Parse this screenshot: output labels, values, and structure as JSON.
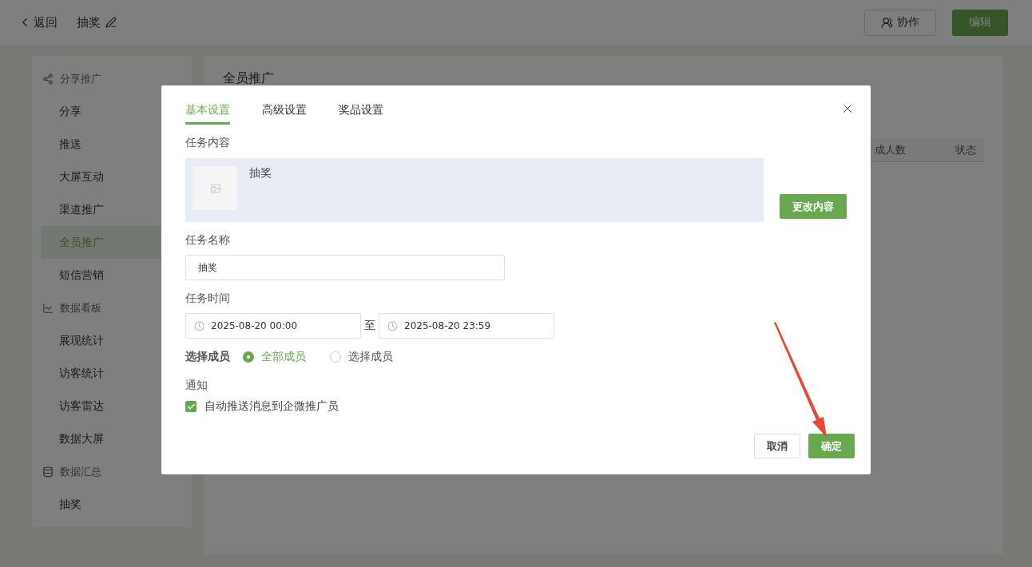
{
  "header": {
    "back": "返回",
    "title": "抽奖",
    "actions": [
      {
        "label": "协作",
        "kind": "outline"
      },
      {
        "label": "编辑",
        "kind": "primary"
      }
    ]
  },
  "sidebar": {
    "groups": [
      {
        "label": "分享推广",
        "kind": "share",
        "items": [
          {
            "label": "分享",
            "selected": false
          },
          {
            "label": "推送",
            "selected": false
          },
          {
            "label": "大屏互动",
            "selected": false
          },
          {
            "label": "渠道推广",
            "selected": false
          },
          {
            "label": "全员推广",
            "selected": true
          },
          {
            "label": "短信营销",
            "selected": false
          }
        ]
      },
      {
        "label": "数据看板",
        "kind": "chart",
        "items": [
          {
            "label": "展现统计",
            "selected": false
          },
          {
            "label": "访客统计",
            "selected": false
          },
          {
            "label": "访客雷达",
            "selected": false
          },
          {
            "label": "数据大屏",
            "selected": false
          }
        ]
      },
      {
        "label": "数据汇总",
        "kind": "database",
        "items": [
          {
            "label": "抽奖",
            "selected": false
          }
        ]
      }
    ]
  },
  "panel": {
    "title": "全员推广",
    "table": {
      "columns": [
        "成人数",
        "状态"
      ]
    }
  },
  "dialog": {
    "tabs": [
      {
        "label": "基本设置",
        "selected": true
      },
      {
        "label": "高级设置",
        "selected": false
      },
      {
        "label": "奖品设置",
        "selected": false
      }
    ],
    "content_label": "任务内容",
    "content": {
      "title": "抽奖"
    },
    "change_button": "更改内容",
    "name_label": "任务名称",
    "name_value": "抽奖",
    "time_label": "任务时间",
    "start": "2025-08-20 00:00",
    "separator": "至",
    "end": "2025-08-20 23:59",
    "members_label": "选择成员",
    "member_options": [
      {
        "label": "全部成员",
        "selected": true
      },
      {
        "label": "选择成员",
        "selected": false
      }
    ],
    "notify_label": "通知",
    "notify_option": {
      "label": "自动推送消息到企微推广员",
      "checked": true
    },
    "buttons": [
      {
        "label": "取消",
        "kind": "default"
      },
      {
        "label": "确定",
        "kind": "primary"
      }
    ]
  }
}
